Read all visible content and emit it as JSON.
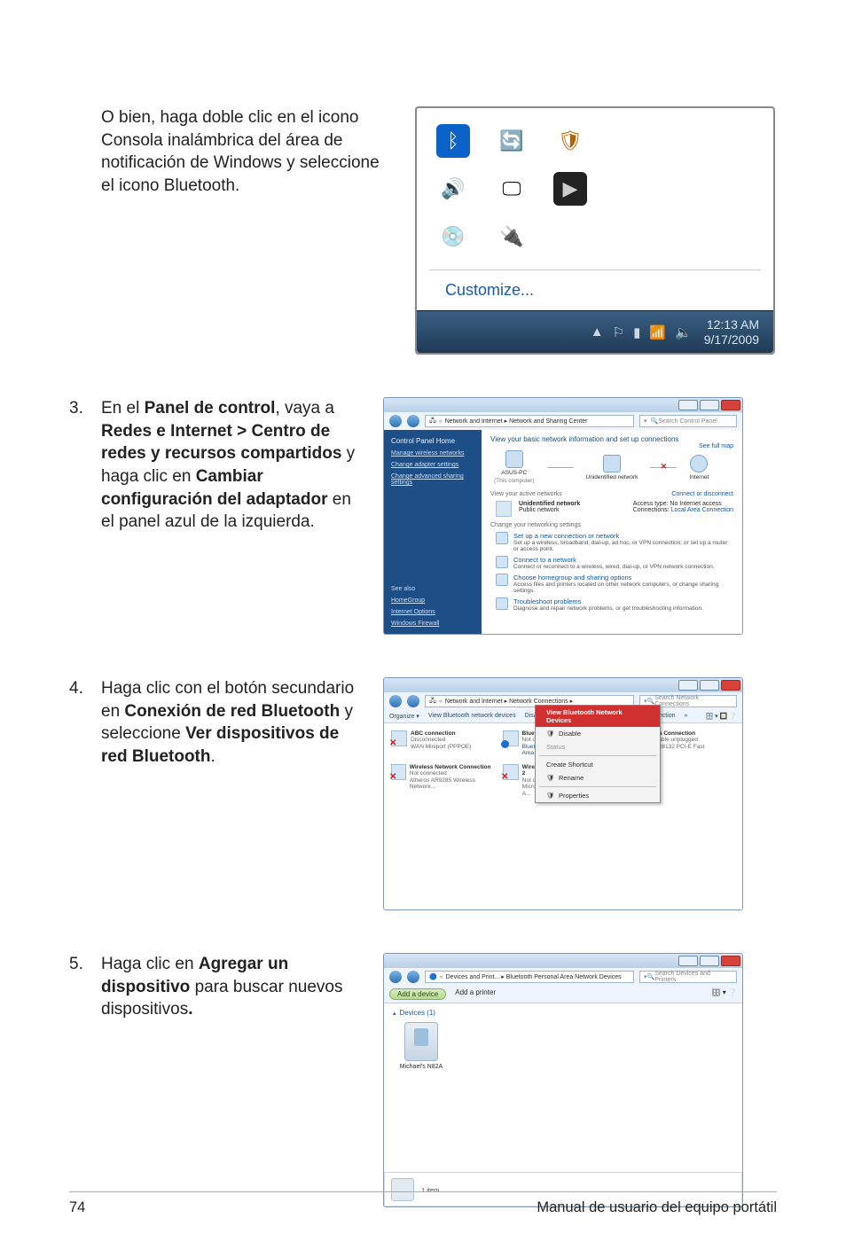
{
  "intro": "O bien, haga doble clic en el icono Consola inalámbrica del área de notificación de Windows y seleccione el icono Bluetooth.",
  "steps": {
    "s3": {
      "num": "3.",
      "body_parts": [
        "En el ",
        "Panel de control",
        ", vaya a ",
        "Redes e Internet > Centro de redes y recursos compartidos",
        " y haga clic en ",
        "Cambiar configuración del adaptador",
        " en el panel azul de la izquierda."
      ]
    },
    "s4": {
      "num": "4.",
      "body_parts": [
        "Haga clic con el botón secundario en ",
        "Conexión de red Bluetooth",
        " y seleccione ",
        "Ver dispositivos de red Bluetooth",
        "."
      ]
    },
    "s5": {
      "num": "5.",
      "body_parts": [
        "Haga clic en ",
        "Agregar un dispositivo",
        " para buscar nuevos dispositivos",
        "."
      ]
    }
  },
  "tray": {
    "customize": "Customize...",
    "clock_time": "12:13 AM",
    "clock_date": "9/17/2009"
  },
  "nsc": {
    "crumb": "Network and Internet ▸ Network and Sharing Center",
    "search_ph": "Search Control Panel",
    "left": {
      "home": "Control Panel Home",
      "manage": "Manage wireless networks",
      "adapter": "Change adapter settings",
      "advanced": "Change advanced sharing settings",
      "seealso": "See also",
      "homegroup": "HomeGroup",
      "ioptions": "Internet Options",
      "firewall": "Windows Firewall"
    },
    "right": {
      "viewbasic": "View your basic network information and set up connections",
      "fullmap": "See full map",
      "node1": "ASUS-PC",
      "node1b": "(This computer)",
      "node2": "Unidentified network",
      "node3": "Internet",
      "activehdr": "View your active networks",
      "conndis": "Connect or disconnect",
      "unidnet": "Unidentified network",
      "pubnet": "Public network",
      "accesstype_l": "Access type:",
      "accesstype_v": "No Internet access",
      "connections_l": "Connections:",
      "connections_v": "Local Area Connection",
      "changehdr": "Change your networking settings",
      "tasks": [
        {
          "t": "Set up a new connection or network",
          "d": "Set up a wireless, broadband, dial-up, ad hoc, or VPN connection; or set up a router or access point."
        },
        {
          "t": "Connect to a network",
          "d": "Connect or reconnect to a wireless, wired, dial-up, or VPN network connection."
        },
        {
          "t": "Choose homegroup and sharing options",
          "d": "Access files and printers located on other network computers, or change sharing settings."
        },
        {
          "t": "Troubleshoot problems",
          "d": "Diagnose and repair network problems, or get troubleshooting information."
        }
      ]
    }
  },
  "nc": {
    "crumb": "Network and Internet ▸ Network Connections ▸",
    "search_ph": "Search Network Connections",
    "toolbar": [
      "Organize ▾",
      "View Bluetooth network devices",
      "Disable this network device",
      "Rename this connection",
      "»"
    ],
    "conns": [
      {
        "n1": "ABC connection",
        "n2": "Disconnected",
        "n3": "WAN Miniport (PPPOE)",
        "ov": "x"
      },
      {
        "n1": "Bluetooth Network Connection",
        "n2": "Not connected",
        "n3": "Bluetooth Device (Personal Area...",
        "ov": "b"
      },
      {
        "n1": "Local Area Connection",
        "n2": "Network cable unplugged",
        "n3": "Atheros AR8132 PCI-E Fast Ethern...",
        "ov": "x"
      },
      {
        "n1": "Wireless Network Connection",
        "n2": "Not connected",
        "n3": "Atheros AR9285 Wireless Network...",
        "ov": "x"
      },
      {
        "n1": "Wireless Network Connection 2",
        "n2": "Not connected",
        "n3": "Microsoft Virtual WiFi Miniport A...",
        "ov": "x"
      }
    ],
    "menu": [
      "View Bluetooth Network Devices",
      "Disable",
      "Status",
      "",
      "Create Shortcut",
      "Rename",
      "",
      "Properties"
    ]
  },
  "dev": {
    "crumb": "Devices and Print... ▸ Bluetooth Personal Area Network Devices",
    "search_ph": "Search Devices and Printers",
    "add_device": "Add a device",
    "add_printer": "Add a printer",
    "cat": "Devices (1)",
    "device_name": "Michael's N82A",
    "status": "1 item"
  },
  "footer": {
    "page": "74",
    "title": "Manual de usuario del equipo portátil"
  }
}
